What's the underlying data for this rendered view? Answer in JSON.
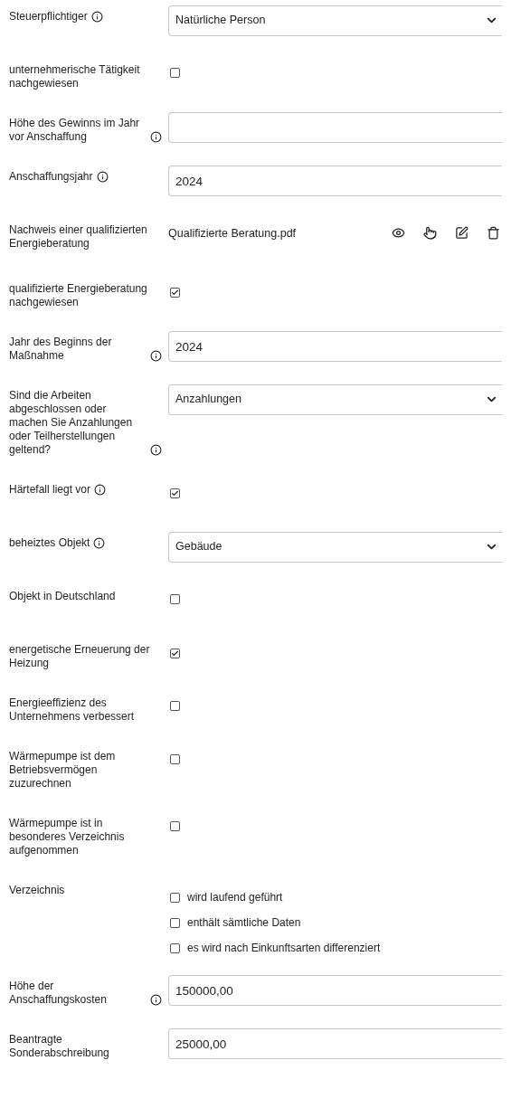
{
  "rows": [
    {
      "kind": "select",
      "label": "Steuerpflichtiger",
      "info": true,
      "value": "Natürliche Person"
    },
    {
      "kind": "checkbox",
      "label": "unternehmerische Tätigkeit nachgewiesen",
      "info": false,
      "checked": false
    },
    {
      "kind": "text",
      "label": "Höhe des Gewinns im Jahr vor Anschaffung",
      "info": true
    },
    {
      "kind": "text",
      "label": "Anschaffungsjahr",
      "info": true,
      "value": "2024"
    },
    {
      "kind": "file",
      "label": "Nachweis einer qualifizierten Energieberatung",
      "info": false,
      "value": "Qualifizierte Beratung.pdf"
    },
    {
      "kind": "checkbox",
      "label": "qualifizierte Energieberatung nachgewiesen",
      "info": false,
      "checked": true
    },
    {
      "kind": "text",
      "label": "Jahr des Beginns der Maßnahme",
      "info": true,
      "value": "2024"
    },
    {
      "kind": "select",
      "label": "Sind die Arbeiten abgeschlossen oder machen Sie Anzahlungen oder Teilherstellungen geltend?",
      "info": true,
      "value": "Anzahlungen"
    },
    {
      "kind": "checkbox",
      "label": "Härtefall liegt vor",
      "info": true,
      "checked": true
    },
    {
      "kind": "select",
      "label": "beheiztes Objekt",
      "info": true,
      "value": "Gebäude"
    },
    {
      "kind": "checkbox",
      "label": "Objekt in Deutschland",
      "info": false,
      "checked": false
    },
    {
      "kind": "checkbox",
      "label": "energetische Erneuerung der Heizung",
      "info": false,
      "checked": true
    },
    {
      "kind": "checkbox",
      "label": "Energieeffizienz des Unternehmens verbessert",
      "info": false,
      "checked": false
    },
    {
      "kind": "checkbox",
      "label": "Wärmepumpe ist dem Betriebsvermögen zuzurechnen",
      "info": false,
      "checked": false
    },
    {
      "kind": "checkbox",
      "label": "Wärmepumpe ist in besonderes Verzeichnis aufgenommen",
      "info": false,
      "checked": false
    },
    {
      "kind": "checkgroup",
      "label": "Verzeichnis",
      "info": false,
      "options": [
        {
          "label": "wird laufend geführt",
          "checked": false
        },
        {
          "label": "enthält sämtliche Daten",
          "checked": false
        },
        {
          "label": "es wird nach Einkunftsarten differenziert",
          "checked": false
        }
      ]
    },
    {
      "kind": "text",
      "label": "Höhe der Anschaffungskosten",
      "info": true,
      "value": "150000,00"
    },
    {
      "kind": "text",
      "label": "Beantragte Sonderabschreibung",
      "info": false,
      "value": "25000,00"
    }
  ]
}
